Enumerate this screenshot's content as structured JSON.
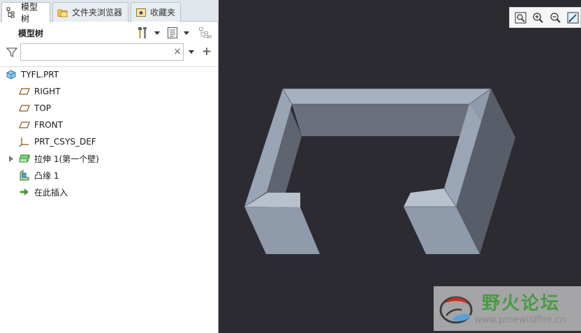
{
  "tabs": [
    {
      "label": "模型树",
      "icon": "model-tree-icon",
      "active": true
    },
    {
      "label": "文件夹浏览器",
      "icon": "folder-browser-icon",
      "active": false
    },
    {
      "label": "收藏夹",
      "icon": "favorites-icon",
      "active": false
    }
  ],
  "panel": {
    "title": "模型树",
    "toolbar_icons": [
      "tools-icon",
      "settings-list-icon",
      "show-hide-icon"
    ]
  },
  "filter": {
    "value": "",
    "placeholder": "",
    "clear_glyph": "×",
    "add_glyph": "+"
  },
  "tree": {
    "items": [
      {
        "label": "TYFL.PRT",
        "icon": "part-icon"
      },
      {
        "label": "RIGHT",
        "icon": "datum-plane-icon"
      },
      {
        "label": "TOP",
        "icon": "datum-plane-icon"
      },
      {
        "label": "FRONT",
        "icon": "datum-plane-icon"
      },
      {
        "label": "PRT_CSYS_DEF",
        "icon": "coordinate-system-icon"
      },
      {
        "label": "拉伸 1(第一个壁)",
        "icon": "extrude-wall-icon",
        "expandable": true
      },
      {
        "label": "凸缘 1",
        "icon": "flange-icon"
      },
      {
        "label": "在此插入",
        "icon": "insert-here-arrow-icon"
      }
    ]
  },
  "viewport": {
    "background": "#2c2b32",
    "view_buttons": [
      "zoom-fit-icon",
      "zoom-in-icon",
      "zoom-out-icon",
      "repaint-icon"
    ]
  },
  "watermark": {
    "title": "野火论坛",
    "url": "www.proewildfire.cn"
  },
  "colors": {
    "accent_green": "#4b9a45",
    "part_face_light": "#a8b3c2",
    "part_face_dark": "#5d6574"
  }
}
